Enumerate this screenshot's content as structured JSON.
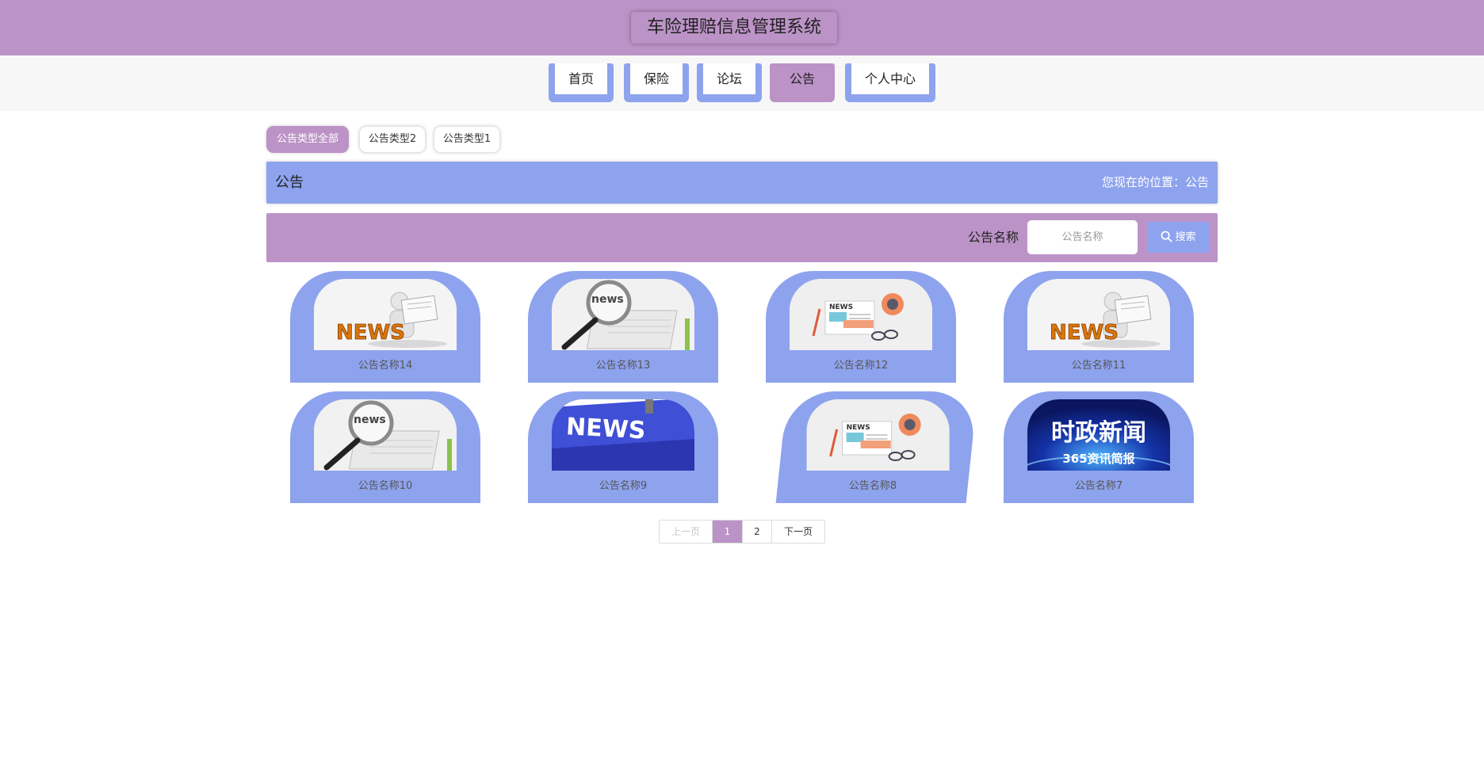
{
  "app": {
    "title": "车险理赔信息管理系统"
  },
  "nav": {
    "items": [
      {
        "label": "首页",
        "active": false
      },
      {
        "label": "保险",
        "active": false
      },
      {
        "label": "论坛",
        "active": false
      },
      {
        "label": "公告",
        "active": true
      },
      {
        "label": "个人中心",
        "active": false
      }
    ]
  },
  "categories": {
    "items": [
      {
        "label": "公告类型全部",
        "active": true
      },
      {
        "label": "公告类型2",
        "active": false
      },
      {
        "label": "公告类型1",
        "active": false
      }
    ]
  },
  "section": {
    "title": "公告",
    "location_label": "您现在的位置：",
    "location_value": "公告"
  },
  "search": {
    "label": "公告名称",
    "placeholder": "公告名称",
    "button_label": "搜索"
  },
  "cards": [
    {
      "title": "公告名称14",
      "image": "news-man-reading"
    },
    {
      "title": "公告名称13",
      "image": "news-magnifier"
    },
    {
      "title": "公告名称12",
      "image": "newspaper-glasses"
    },
    {
      "title": "公告名称11",
      "image": "news-man-reading"
    },
    {
      "title": "公告名称10",
      "image": "news-magnifier"
    },
    {
      "title": "公告名称9",
      "image": "news-keyboard-key"
    },
    {
      "title": "公告名称8",
      "image": "newspaper-glasses"
    },
    {
      "title": "公告名称7",
      "image": "political-news-banner"
    }
  ],
  "image_text": {
    "news_word": "NEWS",
    "news_small": "news",
    "banner_main": "时政新闻",
    "banner_sub": "365资讯简报"
  },
  "pagination": {
    "prev_label": "上一页",
    "pages": [
      "1",
      "2"
    ],
    "current": "1",
    "next_label": "下一页"
  },
  "colors": {
    "purple": "#bc93c7",
    "blue": "#8ea3ee",
    "white": "#ffffff"
  }
}
